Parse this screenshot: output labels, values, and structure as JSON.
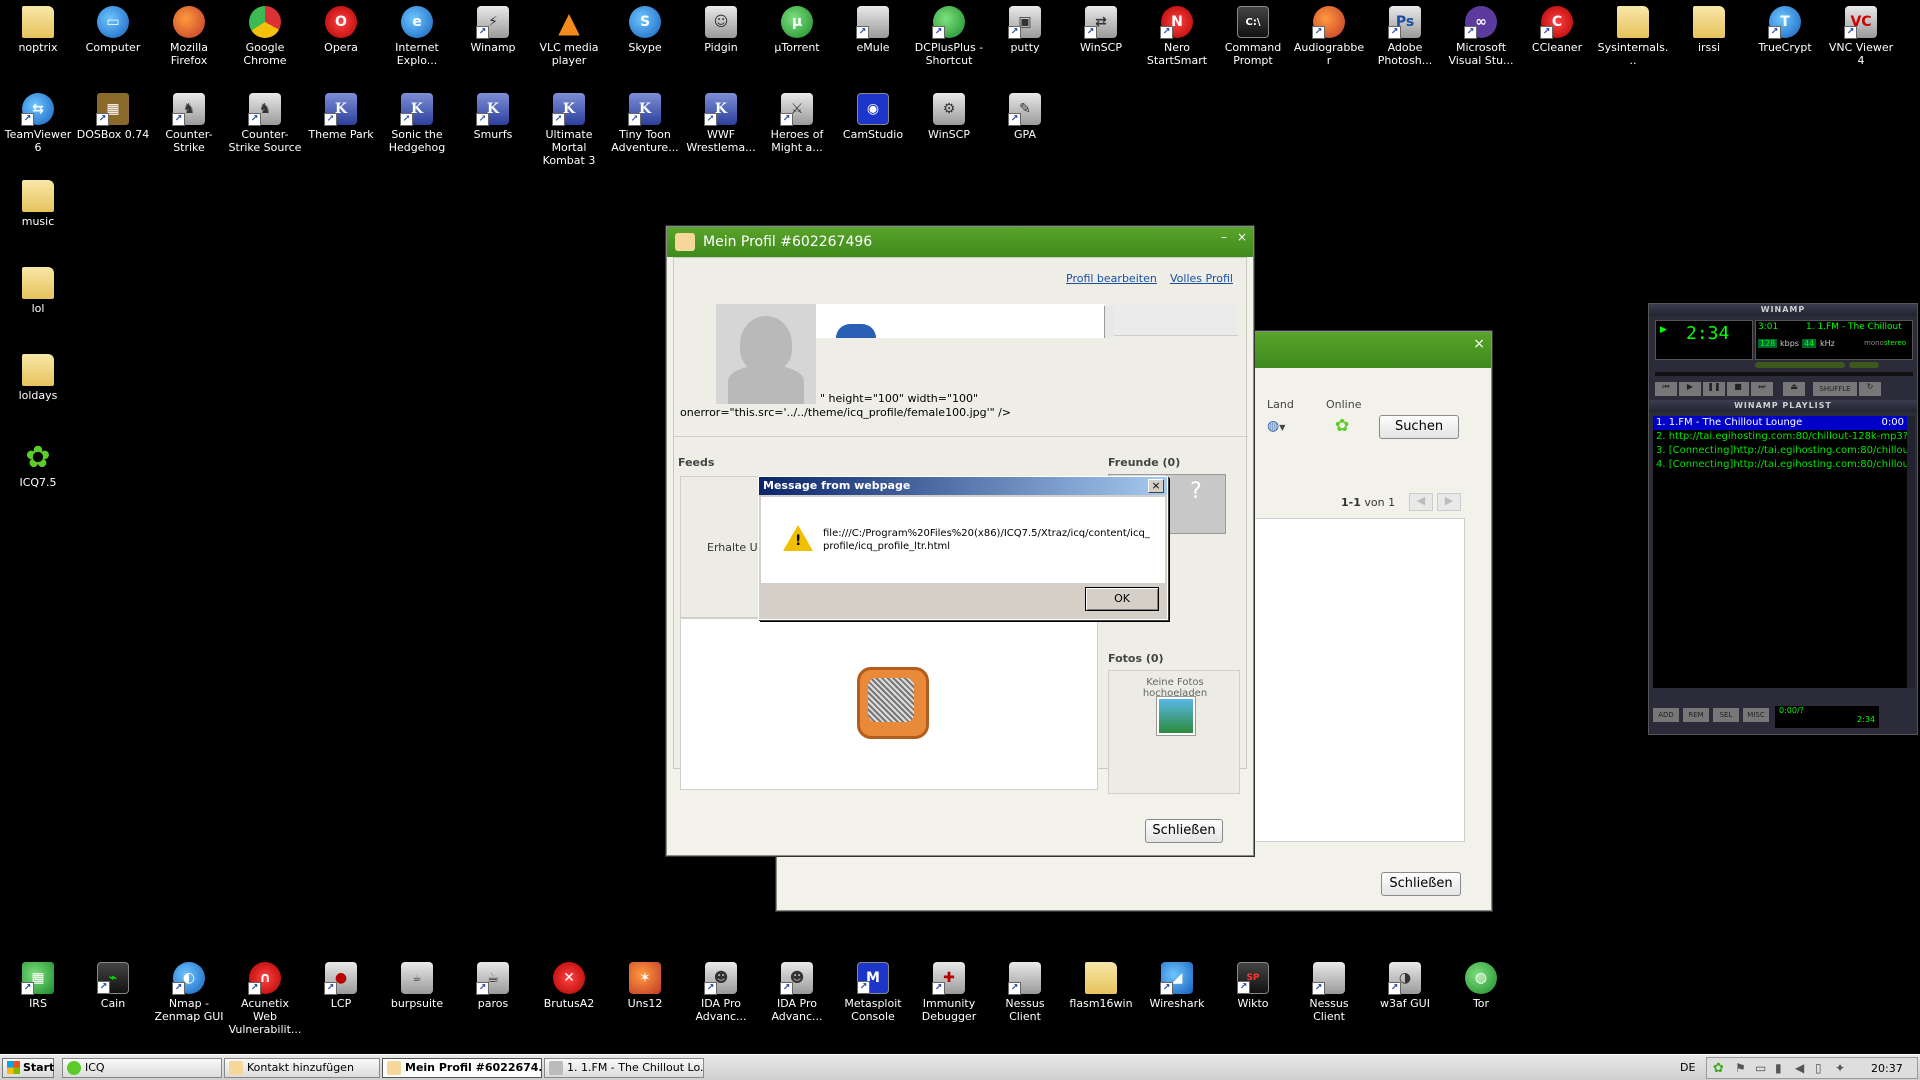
{
  "desktop_row1": [
    "noptrix",
    "Computer",
    "Mozilla Firefox",
    "Google Chrome",
    "Opera",
    "Internet Explo...",
    "Winamp",
    "VLC media player",
    "Skype",
    "Pidgin",
    "µTorrent",
    "eMule",
    "DCPlusPlus - Shortcut",
    "putty",
    "WinSCP",
    "Nero StartSmart",
    "Command Prompt",
    "Audiograbber",
    "Adobe Photosh...",
    "Microsoft Visual Stu...",
    "CCleaner",
    "Sysinternals...",
    "irssi",
    "TrueCrypt",
    "VNC Viewer 4"
  ],
  "desktop_row2": [
    "TeamViewer 6",
    "DOSBox 0.74",
    "Counter-Strike",
    "Counter-Strike Source",
    "Theme Park",
    "Sonic the Hedgehog",
    "Smurfs",
    "Ultimate Mortal Kombat 3",
    "Tiny Toon Adventure...",
    "WWF Wrestlema...",
    "Heroes of Might a...",
    "CamStudio",
    "WinSCP",
    "GPA"
  ],
  "desktop_col": [
    "music",
    "lol",
    "loldays",
    "ICQ7.5"
  ],
  "desktop_bottom": [
    "IRS",
    "Cain",
    "Nmap - Zenmap GUI",
    "Acunetix Web Vulnerabilit...",
    "LCP",
    "burpsuite",
    "paros",
    "BrutusA2",
    "Uns12",
    "IDA Pro Advanc...",
    "IDA Pro Advanc...",
    "Metasploit Console",
    "Immunity Debugger",
    "Nessus Client",
    "flasm16win",
    "Wireshark",
    "Wikto",
    "Nessus Client",
    "w3af GUI",
    "Tor"
  ],
  "profile_window": {
    "title": "Mein Profil #602267496",
    "edit_link": "Profil bearbeiten",
    "full_link": "Volles Profil",
    "broken_html_1": "\" height=\"100\" width=\"100\"",
    "broken_html_2": "onerror=\"this.src='../../theme/icq_profile/female100.jpg'\" />",
    "feeds_label": "Feeds",
    "feeds_text": "Erhalte Up",
    "friends_label": "Freunde (0)",
    "photos_label": "Fotos (0)",
    "no_photos": "Keine Fotos hochoeladen",
    "close_button": "Schließen",
    "minimize": "–",
    "close": "×"
  },
  "contact_window": {
    "land_label": "Land",
    "online_label": "Online",
    "search_button": "Suchen",
    "paging": "1-1",
    "paging_of": "von 1",
    "close_button": "Schließen",
    "close": "×"
  },
  "dialog": {
    "title": "Message from webpage",
    "message": "file:///C:/Program%20Files%20(x86)/ICQ7.5/Xtraz/icq/content/icq_profile/icq_profile_ltr.html",
    "ok": "OK",
    "close": "×"
  },
  "winamp": {
    "title": "WINAMP",
    "time": "2:34",
    "song": "1. 1.FM - The Chillout",
    "counter": "3:01",
    "kbps": "128",
    "khz": "44",
    "kbps_label": "kbps",
    "khz_label": "kHz",
    "mono": "mono",
    "stereo": "stereo",
    "shuffle": "SHUFFLE",
    "playlist_title": "WINAMP PLAYLIST",
    "playlist": [
      {
        "text": "1. 1.FM - The Chillout Lounge",
        "time": "0:00"
      },
      {
        "text": "2. http://tai.egihosting.com:80/chillout-128k-mp3?...",
        "time": ""
      },
      {
        "text": "3. [Connecting]http://tai.egihosting.com:80/chillou...",
        "time": ""
      },
      {
        "text": "4. [Connecting]http://tai.egihosting.com:80/chillou...",
        "time": ""
      }
    ],
    "pl_buttons": [
      "ADD",
      "REM",
      "SEL",
      "MISC"
    ],
    "pl_time": "0:00/?",
    "pl_time2": "2:34"
  },
  "taskbar": {
    "start": "Start",
    "tasks": [
      "ICQ",
      "Kontakt hinzufügen",
      "Mein Profil #6022674...",
      "1. 1.FM - The Chillout Lo..."
    ],
    "lang": "DE",
    "clock": "20:37"
  }
}
